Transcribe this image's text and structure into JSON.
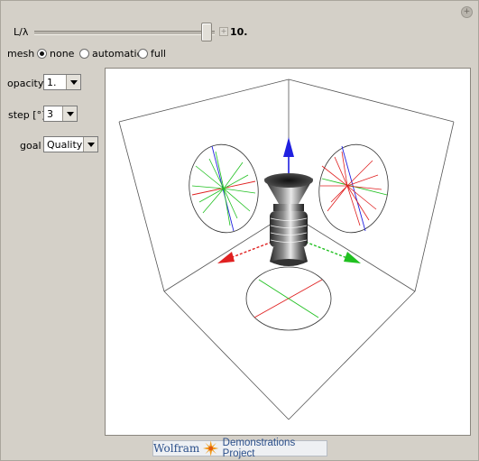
{
  "controls": {
    "lambda_label": "L/λ",
    "lambda_value": "10.",
    "lambda_fraction": 0.95,
    "mesh_label": "mesh",
    "mesh_options": [
      "none",
      "automatic",
      "full"
    ],
    "mesh_selected": "none",
    "opacity_label": "opacity",
    "opacity_value": "1.",
    "step_label": "step [°]",
    "step_value": "3",
    "goal_label": "goal",
    "goal_value": "Quality"
  },
  "footer": {
    "brand": "Wolfram",
    "suffix": "Demonstrations Project"
  },
  "colors": {
    "x_axis": "#e02020",
    "y_axis": "#20c020",
    "z_axis": "#2020e0",
    "background": "#d4d0c8"
  },
  "icons": [
    "plus-icon",
    "dropdown-arrow-icon",
    "starburst-logo-icon"
  ]
}
